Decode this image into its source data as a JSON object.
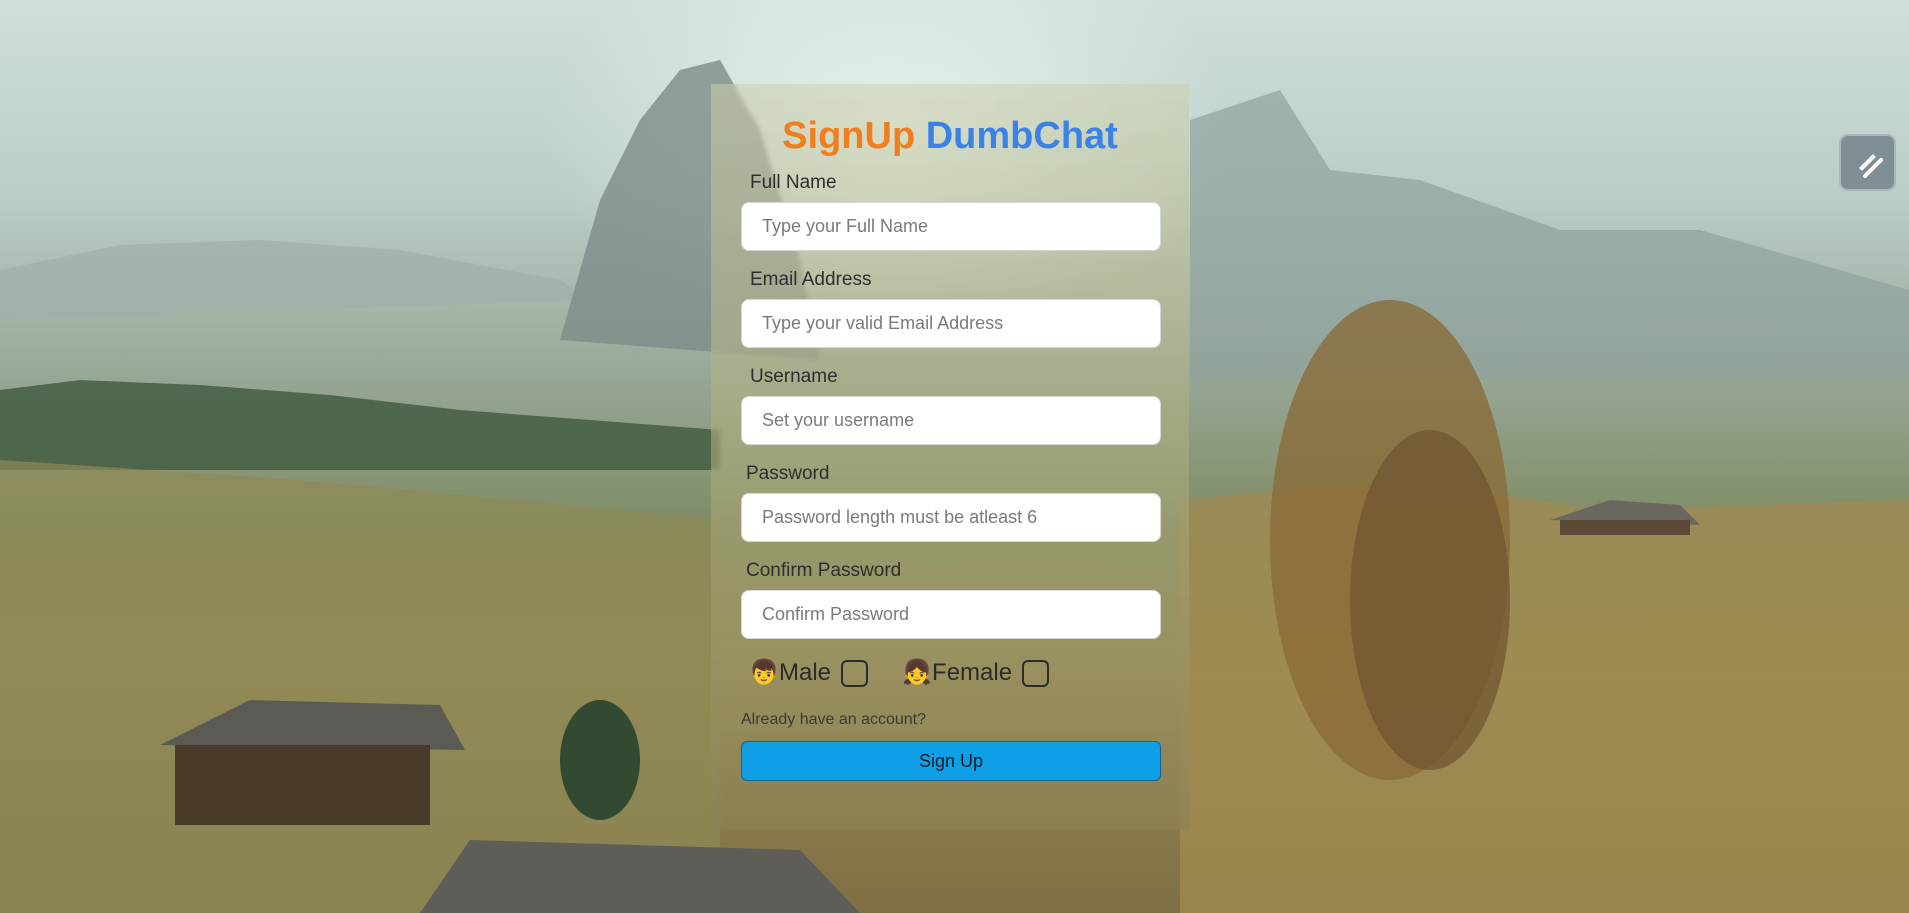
{
  "signup": {
    "title_part1": "SignUp",
    "title_part2": "DumbChat",
    "fields": [
      {
        "label": "Full Name",
        "placeholder": "Type your Full Name"
      },
      {
        "label": "Email Address",
        "placeholder": "Type your valid Email Address"
      },
      {
        "label": "Username",
        "placeholder": "Set your username"
      },
      {
        "label": "Password",
        "placeholder": "Password length must be atleast 6"
      },
      {
        "label": "Confirm Password",
        "placeholder": "Confirm Password"
      }
    ],
    "gender": {
      "male_label": "Male",
      "female_label": "Female",
      "male_icon": "👦",
      "female_icon": "👧"
    },
    "login_link": "Already have an account?",
    "submit_label": "Sign Up"
  },
  "colors": {
    "title_accent_1": "#f07e1f",
    "title_accent_2": "#3b82e8",
    "button_bg": "#0e9fe6"
  },
  "icons": {
    "corner_button": "pen-slash-icon"
  }
}
